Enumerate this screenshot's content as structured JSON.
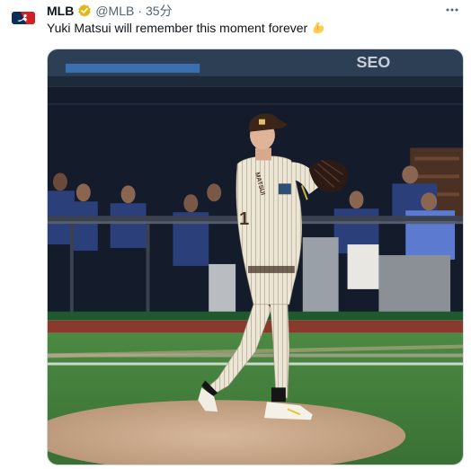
{
  "account": {
    "name": "MLB",
    "handle": "@MLB",
    "separator": "·",
    "time": "35分",
    "logo_icon": "mlb-logo-icon",
    "verified_icon": "gold-verified-badge-icon",
    "verified_color": "#e2b719"
  },
  "tweet": {
    "text": "Yuki Matsui will remember this moment forever",
    "emoji_icon": "flexed-biceps-emoji-icon"
  },
  "menu": {
    "icon": "more-options-icon"
  },
  "media": {
    "type": "video-still",
    "description_icon": "baseball-pitcher-image",
    "jersey_number": "1",
    "jersey_name": "MATSUI",
    "stadium_sign": "SEO"
  },
  "colors": {
    "text_primary": "#0f1419",
    "text_secondary": "#536471",
    "field_green": "#3f7a3a",
    "dirt": "#c9a98a",
    "wall_navy": "#141c2c"
  }
}
